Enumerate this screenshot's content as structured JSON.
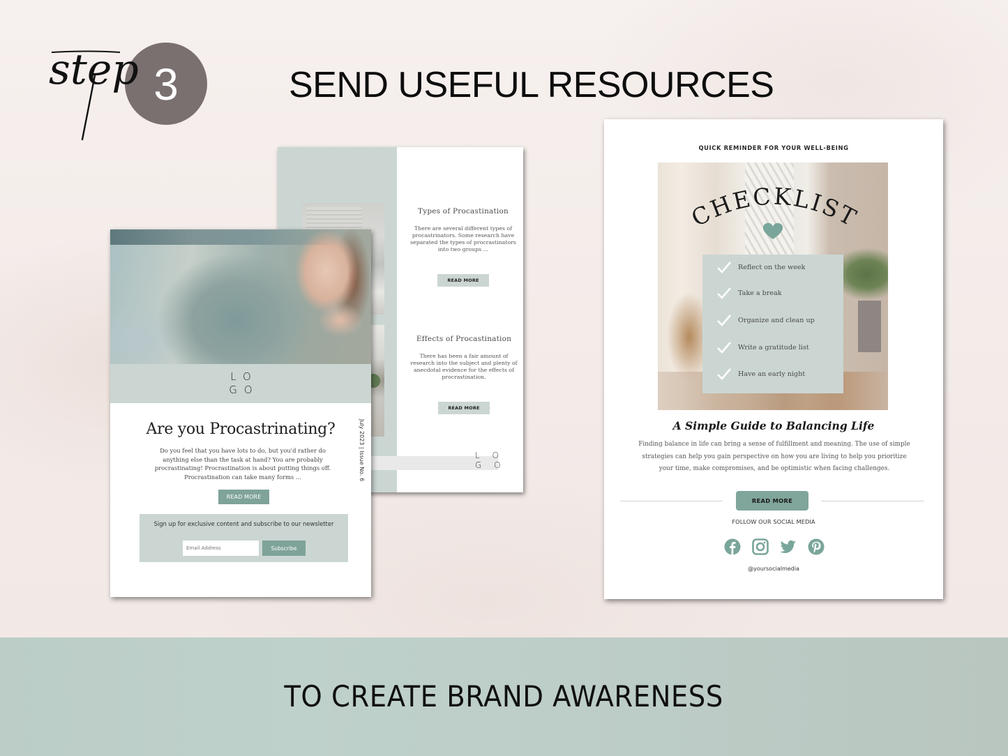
{
  "header": {
    "step_script": "step",
    "step_number": "3",
    "title": "SEND USEFUL RESOURCES"
  },
  "footer": {
    "tagline": "TO CREATE BRAND AWARENESS"
  },
  "colors": {
    "sage": "#cbd6d3",
    "sage_button": "#7fa399",
    "step_circle": "#7a7070",
    "footer_band": "#bccdc7"
  },
  "newsletter_back": {
    "sections": [
      {
        "title": "Types of Procastination",
        "body": "There are several different types of procastrinators. Some research have separated the types of procrastinators into two groups ...",
        "button": "READ MORE"
      },
      {
        "title": "Effects of Procastination",
        "body": "There has been a fair amount of research into the subject and plenty of anecdotal evidence for the effects of procrastination.",
        "button": "READ MORE"
      }
    ],
    "logo": "LOGO"
  },
  "newsletter_front": {
    "logo": "LOGO",
    "title": "Are you Procastrinating?",
    "body": "Do you feel that you have lots to do, but you'd rather do anything else than the task at hand?  You are probably procrastinating! Procrastination is about putting things off. Procrastination can take many forms ...",
    "read_more": "READ MORE",
    "issue": "July 2023 | Issue No. 6",
    "signup_text": "Sign up for exclusive content and subscribe to our newsletter",
    "email_placeholder": "Email Address",
    "subscribe": "Subscribe"
  },
  "checklist_email": {
    "kicker": "QUICK REMINDER FOR YOUR WELL-BEING",
    "arc_title": "CHECKLIST",
    "items": [
      "Reflect on the week",
      "Take a break",
      "Organize and clean up",
      "Write a gratitude list",
      "Have an early night"
    ],
    "guide_title": "A Simple Guide to Balancing Life",
    "guide_body": "Finding balance in life can bring a sense of fulfillment and meaning. The use of simple strategies can help you gain perspective on how you are living to help you prioritize your time, make compromises, and be optimistic when facing challenges.",
    "read_more": "READ MORE",
    "follow": "FOLLOW OUR SOCIAL MEDIA",
    "socials": [
      "facebook-icon",
      "instagram-icon",
      "twitter-icon",
      "pinterest-icon"
    ],
    "handle": "@yoursocialmedia"
  }
}
